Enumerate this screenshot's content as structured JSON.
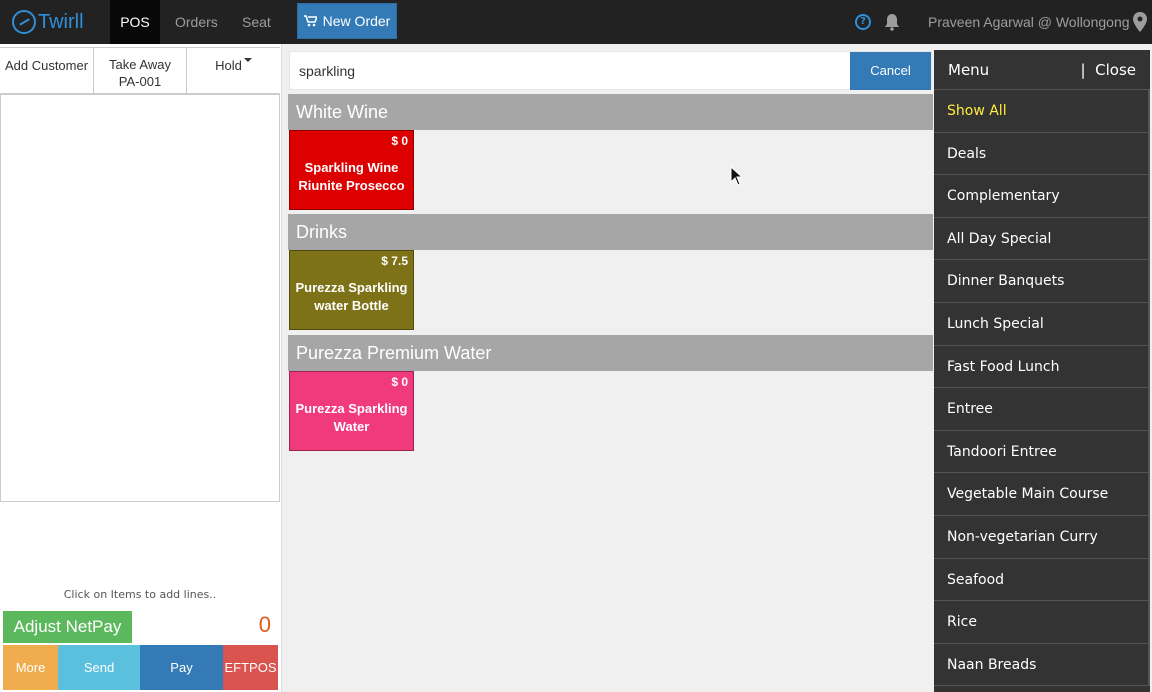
{
  "header": {
    "logo_text": "Twirll",
    "tabs": [
      {
        "label": "POS",
        "active": true
      },
      {
        "label": "Orders",
        "active": false
      },
      {
        "label": "Seat",
        "active": false
      }
    ],
    "new_order_label": "New Order",
    "user_label": "Praveen Agarwal @ Wollongong",
    "help_glyph": "?"
  },
  "ticket": {
    "add_customer": "Add Customer",
    "order_type": "Take Away",
    "order_number": "PA-001",
    "hold_label": "Hold",
    "hint": "Click on Items to add lines..",
    "adjust_label": "Adjust NetPay",
    "total": "0",
    "actions": [
      {
        "label": "More",
        "color": "#f0ad4e"
      },
      {
        "label": "Send",
        "color": "#5bc0de"
      },
      {
        "label": "Pay",
        "color": "#337ab7"
      },
      {
        "label": "EFTPOS",
        "color": "#d9534f"
      }
    ]
  },
  "search": {
    "value": "sparkling",
    "cancel_label": "Cancel"
  },
  "sections": [
    {
      "title": "White Wine",
      "item": {
        "price": "$ 0",
        "name": "Sparkling Wine Riunite Prosecco",
        "color": "#dc0000"
      }
    },
    {
      "title": "Drinks",
      "item": {
        "price": "$ 7.5",
        "name": "Purezza Sparkling water Bottle",
        "color": "#7d7218"
      }
    },
    {
      "title": "Purezza Premium Water",
      "item": {
        "price": "$ 0",
        "name": "Purezza Sparkling Water",
        "color": "#f03a7c"
      }
    }
  ],
  "menu": {
    "title": "Menu",
    "close_label": "|  Close",
    "items": [
      "Show All",
      "Deals",
      "Complementary",
      "All Day Special",
      "Dinner Banquets",
      "Lunch Special",
      "Fast Food Lunch",
      "Entree",
      "Tandoori Entree",
      "Vegetable Main Course",
      "Non-vegetarian Curry",
      "Seafood",
      "Rice",
      "Naan Breads"
    ],
    "selected": "Show All",
    "selected_color": "#ffec3d"
  }
}
